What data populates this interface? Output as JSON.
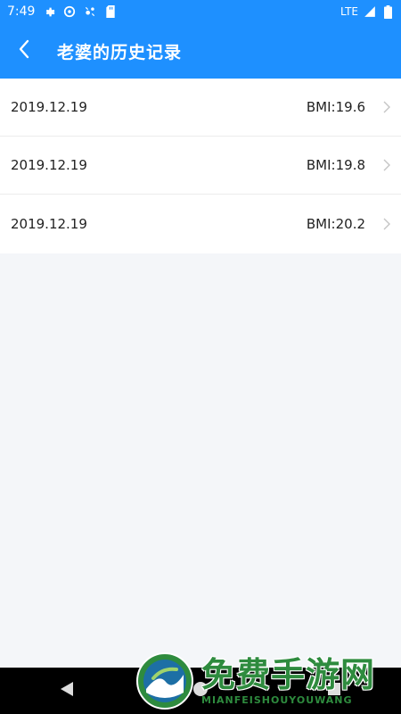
{
  "status_bar": {
    "time": "7:49",
    "network": "LTE",
    "icons": [
      "gear-icon",
      "sync-icon",
      "bug-icon",
      "sd-card-icon",
      "signal-icon",
      "battery-icon"
    ]
  },
  "header": {
    "title": "老婆的历史记录",
    "back_icon": "chevron-left-icon"
  },
  "records": [
    {
      "date": "2019.12.19",
      "bmi": "BMI:19.6"
    },
    {
      "date": "2019.12.19",
      "bmi": "BMI:19.8"
    },
    {
      "date": "2019.12.19",
      "bmi": "BMI:20.2"
    }
  ],
  "nav_bar": {
    "icons": [
      "back-triangle-icon",
      "home-circle-icon",
      "recents-square-icon"
    ]
  },
  "watermark": {
    "cn": "免费手游网",
    "en": "MIANFEISHOUYOUWANG"
  },
  "colors": {
    "primary": "#1e90ff",
    "background": "#f4f6f9",
    "text": "#222222",
    "divider": "#ececec",
    "watermark": "#2e8b3e"
  }
}
